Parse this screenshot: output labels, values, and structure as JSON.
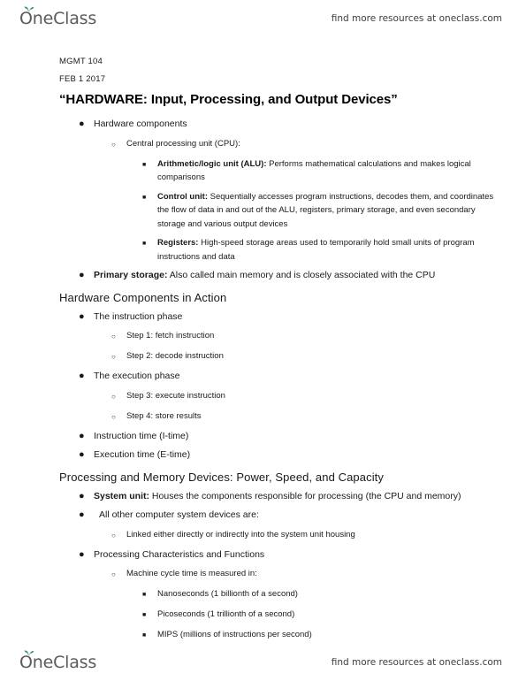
{
  "header": {
    "logo_text": "OneClass",
    "logo_icon": "sprout-icon",
    "note": "find more resources at oneclass.com"
  },
  "footer": {
    "logo_text": "OneClass",
    "logo_icon": "sprout-icon",
    "note": "find more resources at oneclass.com"
  },
  "colors": {
    "brand_green": "#2f8f5b",
    "logo_gray": "#5b5b5b",
    "text": "#1a1a1a"
  },
  "document": {
    "course_code": "MGMT 104",
    "date": "FEB 1 2017",
    "title": "“HARDWARE: Input, Processing, and Output Devices”",
    "sections": [
      {
        "heading": null,
        "items": [
          {
            "level": 1,
            "marker": "disc",
            "bold": "",
            "text": "Hardware components"
          },
          {
            "level": 2,
            "marker": "circle",
            "bold": "",
            "text": "Central processing unit (CPU):"
          },
          {
            "level": 3,
            "marker": "square",
            "bold": "Arithmetic/logic unit (ALU):",
            "text": " Performs mathematical calculations and makes logical comparisons"
          },
          {
            "level": 3,
            "marker": "square",
            "bold": "Control unit:",
            "text": " Sequentially accesses program instructions, decodes them, and coordinates the flow of data in and out of the ALU, registers, primary storage, and even secondary storage and various output devices"
          },
          {
            "level": 3,
            "marker": "square",
            "bold": "Registers:",
            "text": " High-speed storage areas used to temporarily hold small units of program instructions and data"
          },
          {
            "level": 1,
            "marker": "disc",
            "bold": "Primary storage:",
            "text": "  Also called main memory and is closely associated with the CPU"
          }
        ]
      },
      {
        "heading": "Hardware Components in Action",
        "items": [
          {
            "level": 1,
            "marker": "disc",
            "bold": "",
            "text": "The instruction phase"
          },
          {
            "level": 2,
            "marker": "circle",
            "bold": "",
            "text": "Step 1: fetch instruction"
          },
          {
            "level": 2,
            "marker": "circle",
            "bold": "",
            "text": "Step 2: decode instruction"
          },
          {
            "level": 1,
            "marker": "disc",
            "bold": "",
            "text": "The execution phase"
          },
          {
            "level": 2,
            "marker": "circle",
            "bold": "",
            "text": "Step 3: execute instruction"
          },
          {
            "level": 2,
            "marker": "circle",
            "bold": "",
            "text": "Step 4: store results"
          },
          {
            "level": 1,
            "marker": "disc",
            "bold": "",
            "text": "Instruction time (I-time)"
          },
          {
            "level": 1,
            "marker": "disc",
            "bold": "",
            "text": "Execution time (E-time)"
          }
        ]
      },
      {
        "heading": "Processing and Memory Devices: Power, Speed, and Capacity",
        "items": [
          {
            "level": 1,
            "marker": "disc",
            "bold": "System unit:",
            "text": " Houses the components responsible for processing (the CPU and memory)"
          },
          {
            "level": 1,
            "marker": "disc",
            "bold": "",
            "text": "All other computer system devices are:"
          },
          {
            "level": 2,
            "marker": "circle",
            "bold": "",
            "text": "Linked either directly or indirectly into the system unit housing"
          },
          {
            "level": 1,
            "marker": "disc",
            "bold": "",
            "text": "Processing Characteristics and Functions"
          },
          {
            "level": 2,
            "marker": "circle",
            "bold": "",
            "text": "Machine cycle time is measured in:"
          },
          {
            "level": 3,
            "marker": "square",
            "bold": "",
            "text": "Nanoseconds (1 billionth of a second)"
          },
          {
            "level": 3,
            "marker": "square",
            "bold": "",
            "text": "Picoseconds (1 trillionth of a second)"
          },
          {
            "level": 3,
            "marker": "square",
            "bold": "",
            "text": "MIPS (millions of instructions per second)"
          }
        ]
      }
    ]
  }
}
